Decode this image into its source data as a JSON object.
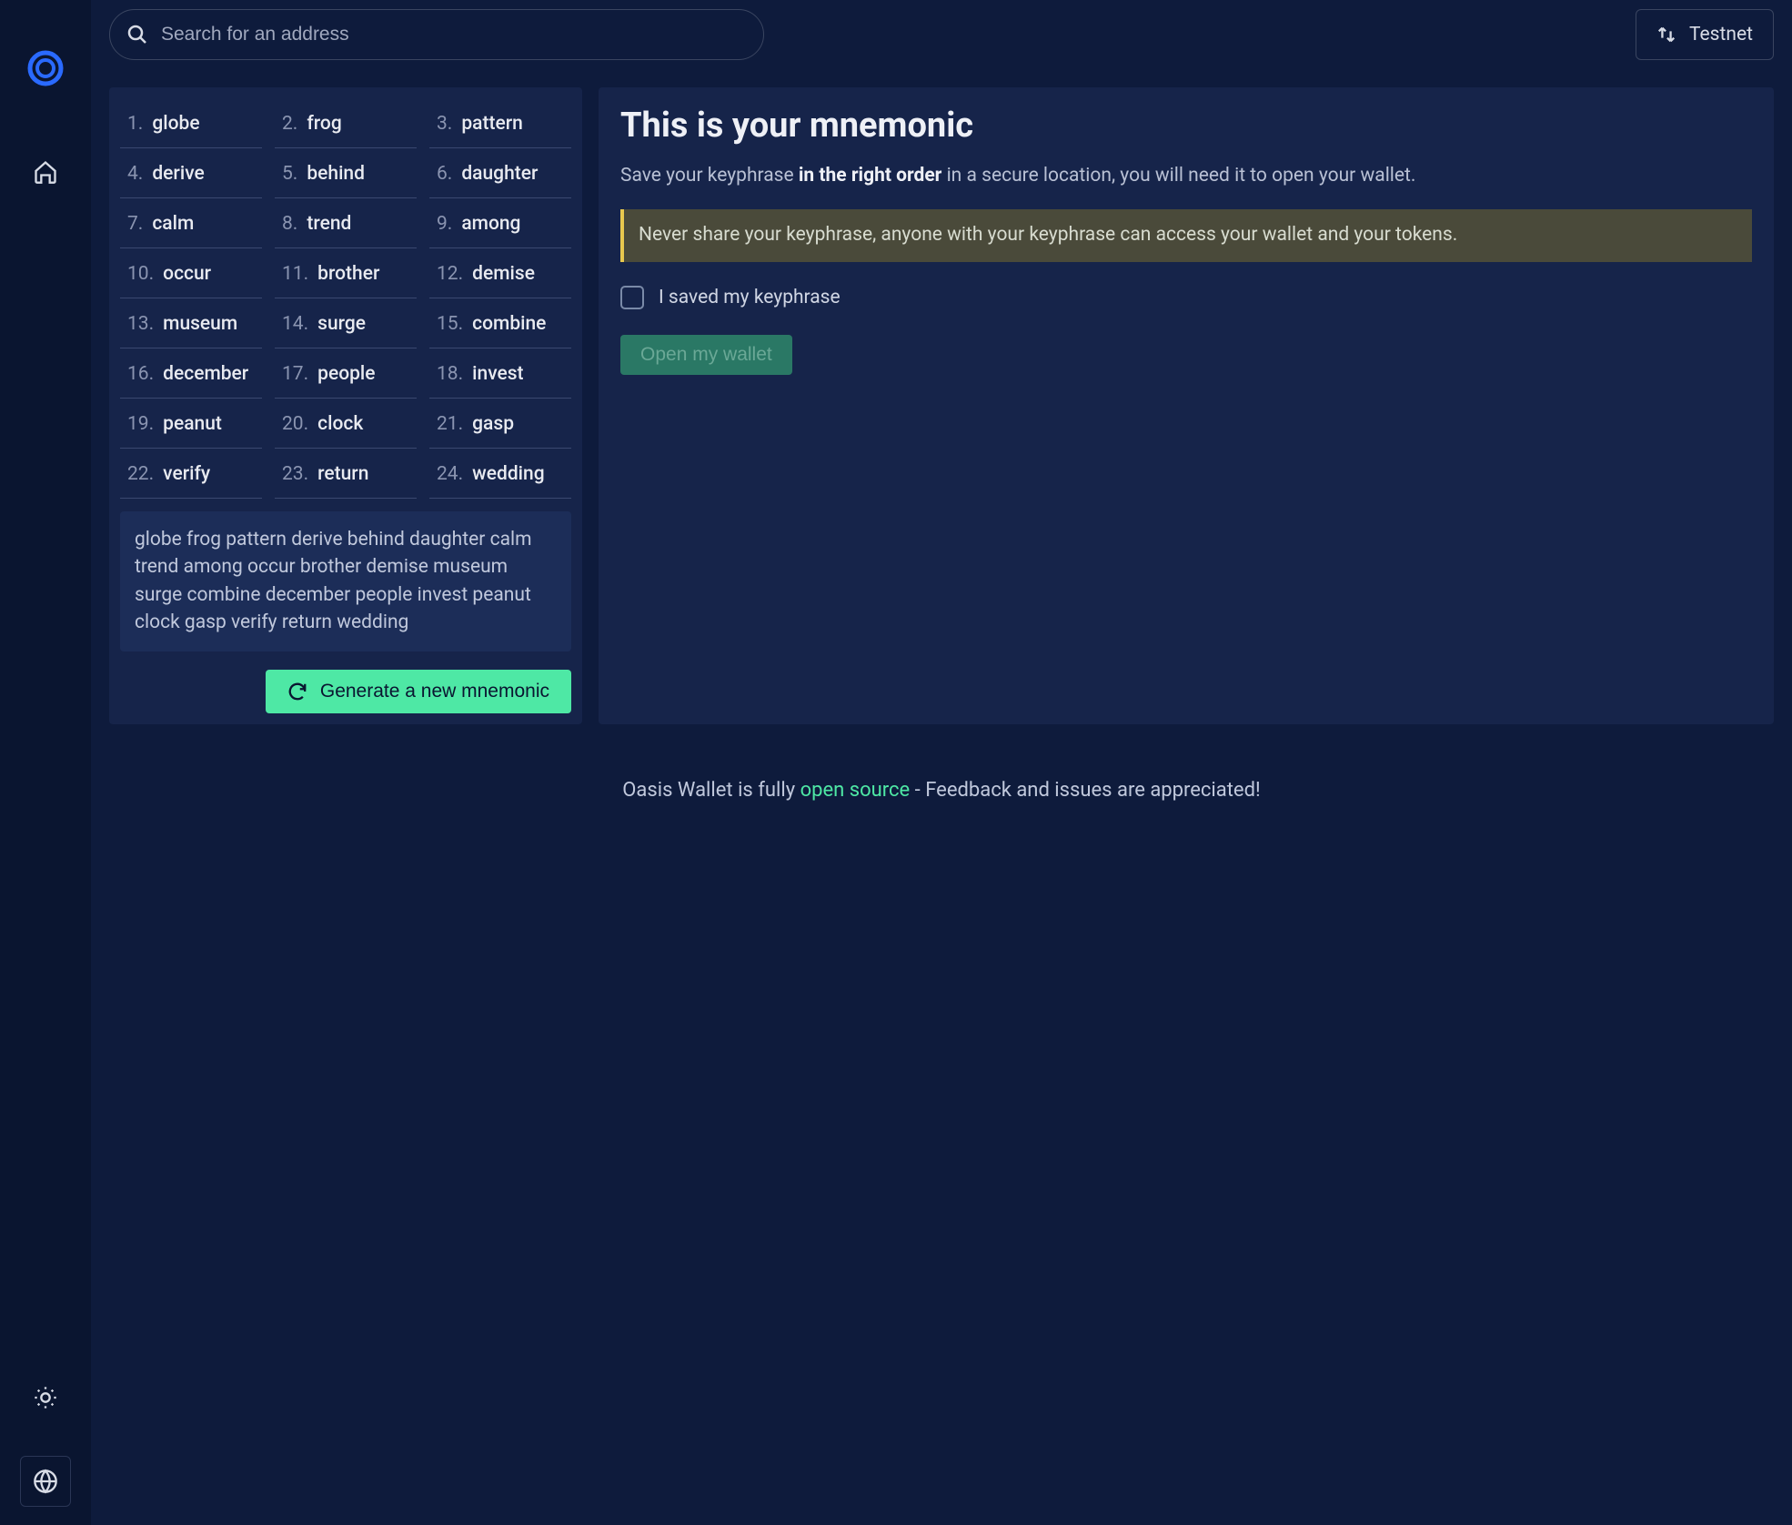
{
  "search": {
    "placeholder": "Search for an address"
  },
  "network": {
    "label": "Testnet"
  },
  "mnemonic": {
    "words": [
      "globe",
      "frog",
      "pattern",
      "derive",
      "behind",
      "daughter",
      "calm",
      "trend",
      "among",
      "occur",
      "brother",
      "demise",
      "museum",
      "surge",
      "combine",
      "december",
      "people",
      "invest",
      "peanut",
      "clock",
      "gasp",
      "verify",
      "return",
      "wedding"
    ],
    "generate_button": "Generate a new mnemonic"
  },
  "info": {
    "title": "This is your mnemonic",
    "subtitle_prefix": "Save your keyphrase ",
    "subtitle_bold": "in the right order",
    "subtitle_suffix": " in a secure location, you will need it to open your wallet.",
    "warning": "Never share your keyphrase, anyone with your keyphrase can access your wallet and your tokens.",
    "checkbox_label": "I saved my keyphrase",
    "open_button": "Open my wallet"
  },
  "footer": {
    "prefix": "Oasis Wallet is fully ",
    "link": "open source",
    "suffix": " - Feedback and issues are appreciated!"
  }
}
